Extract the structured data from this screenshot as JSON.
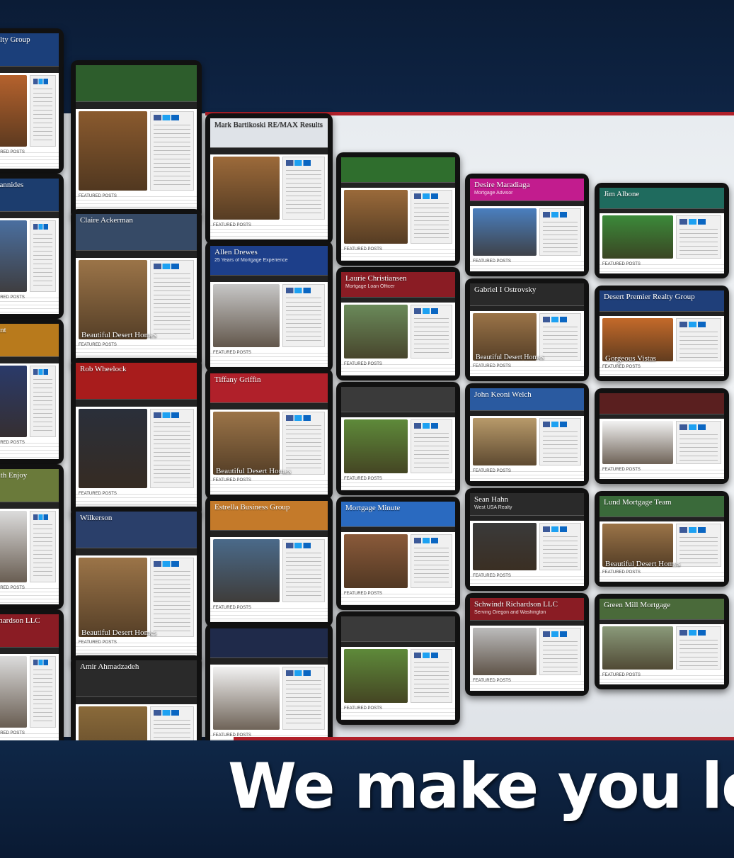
{
  "headline": "We make you look",
  "colors": {
    "navy": "#0b1c36",
    "accent_red": "#b0202a",
    "panel": "#eef1f4"
  },
  "tablets": [
    {
      "name": "Realty Group",
      "sub": "",
      "caption": "",
      "banner": "#1b3f7a",
      "photo": "#b5622d"
    },
    {
      "name": "",
      "sub": "",
      "caption": "",
      "banner": "#2d5d2c",
      "photo": "#8a5a2e"
    },
    {
      "name": "Mark Bartikoski RE/MAX Results",
      "sub": "",
      "caption": "",
      "banner": "#dfe3e8",
      "photo": "#9c6a3a"
    },
    {
      "name": "",
      "sub": "",
      "caption": "",
      "banner": "#2f6e2d",
      "photo": "#9a6a3a"
    },
    {
      "name": "Desire Maradiaga",
      "sub": "Mortgage Advisor",
      "caption": "",
      "banner": "#c21c8e",
      "photo": "#4a7fbf"
    },
    {
      "name": "Jim Albone",
      "sub": "",
      "caption": "",
      "banner": "#1f6b5e",
      "photo": "#3b8a3a"
    },
    {
      "name": "Agiannides",
      "sub": "",
      "caption": "",
      "banner": "#1c3d6e",
      "photo": "#4a6fa0"
    },
    {
      "name": "Claire Ackerman",
      "sub": "",
      "caption": "Beautiful Desert Homes",
      "banner": "#364a66",
      "photo": "#9b7448"
    },
    {
      "name": "Allen Drewes",
      "sub": "25 Years of Mortgage Experience",
      "caption": "",
      "banner": "#1d3f8a",
      "photo": "#c7c7c7"
    },
    {
      "name": "Laurie Christiansen",
      "sub": "Mortgage Loan Officer",
      "caption": "",
      "banner": "#8a1c24",
      "photo": "#6a8a5a"
    },
    {
      "name": "Gabriel I Ostrovsky",
      "sub": "",
      "caption": "Beautiful Desert Homes",
      "banner": "#2a2a2a",
      "photo": "#9b7448"
    },
    {
      "name": "Desert Premier Realty Group",
      "sub": "",
      "caption": "Gorgeous Vistas",
      "banner": "#1f3f7a",
      "photo": "#c46a2a"
    },
    {
      "name": "Event",
      "sub": "",
      "caption": "",
      "banner": "#b87a1c",
      "photo": "#2a3a6a"
    },
    {
      "name": "Rob Wheelock",
      "sub": "",
      "caption": "",
      "banner": "#a81c1c",
      "photo": "#2a2f3a"
    },
    {
      "name": "Tiffany Griffin",
      "sub": "",
      "caption": "Beautiful Desert Homes",
      "banner": "#b0202a",
      "photo": "#9b7448"
    },
    {
      "name": "",
      "sub": "",
      "caption": "",
      "banner": "#3a3a3a",
      "photo": "#5e8a3a"
    },
    {
      "name": "John Keoni Welch",
      "sub": "",
      "caption": "",
      "banner": "#2a5aa0",
      "photo": "#b89a6a"
    },
    {
      "name": "",
      "sub": "",
      "caption": "",
      "banner": "#5a1f1f",
      "photo": "#f2f2f2"
    },
    {
      "name": "Smith Enjoy",
      "sub": "",
      "caption": "",
      "banner": "#6a7a3a",
      "photo": "#dcdcdc"
    },
    {
      "name": "Wilkerson",
      "sub": "",
      "caption": "Beautiful Desert Homes",
      "banner": "#2a3f6a",
      "photo": "#9b7448"
    },
    {
      "name": "Estrella Business Group",
      "sub": "",
      "caption": "",
      "banner": "#c47a2a",
      "photo": "#4a6a8a"
    },
    {
      "name": "Mortgage Minute",
      "sub": "",
      "caption": "",
      "banner": "#2a6ac0",
      "photo": "#8a5a3a"
    },
    {
      "name": "Sean Hahn",
      "sub": "West USA Realty",
      "caption": "",
      "banner": "#2a2a2a",
      "photo": "#3a3a3a"
    },
    {
      "name": "Lund Mortgage Team",
      "sub": "",
      "caption": "Beautiful Desert Homes",
      "banner": "#3a6a3a",
      "photo": "#9b7448"
    },
    {
      "name": "Richardson LLC",
      "sub": "",
      "caption": "",
      "banner": "#8a1c24",
      "photo": "#dcdcdc"
    },
    {
      "name": "Amir Ahmadzadeh",
      "sub": "",
      "caption": "",
      "banner": "#2a2a2a",
      "photo": "#8a6a3a"
    },
    {
      "name": "",
      "sub": "",
      "caption": "",
      "banner": "#1f2a4a",
      "photo": "#f2f2f2"
    },
    {
      "name": "",
      "sub": "",
      "caption": "",
      "banner": "#3a3a3a",
      "photo": "#5e8a3a"
    },
    {
      "name": "Schwindt Richardson LLC",
      "sub": "Serving Oregon and Washington",
      "caption": "",
      "banner": "#8a1c24",
      "photo": "#bcbcbc"
    },
    {
      "name": "Green Mill Mortgage",
      "sub": "",
      "caption": "",
      "banner": "#4a6a3a",
      "photo": "#8a9a7a"
    }
  ],
  "footer_label": "Featured Posts"
}
